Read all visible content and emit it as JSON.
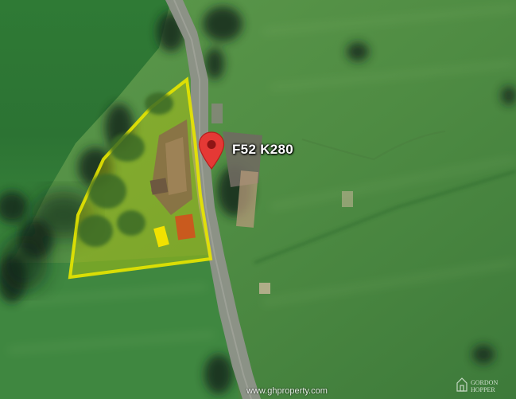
{
  "map": {
    "type": "satellite",
    "pin": {
      "icon": "location-pin-icon",
      "color": "#e53935",
      "label": "F52 K280"
    },
    "highlight_color": "#e8e600",
    "watermark": "www.ghproperty.com",
    "logo": {
      "icon": "agency-logo-icon",
      "line1": "GORDON",
      "line2": "HOPPER"
    }
  }
}
